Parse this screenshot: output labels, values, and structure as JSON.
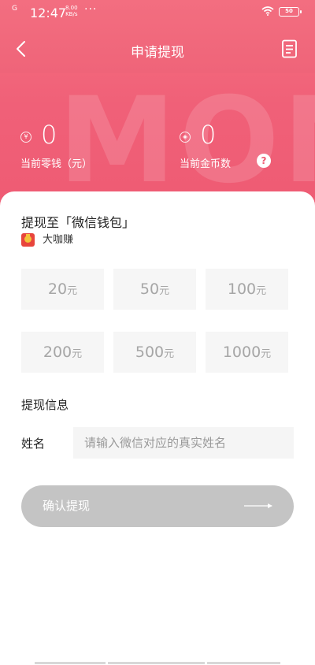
{
  "status_bar": {
    "time": "12:47",
    "signal": "G",
    "speed_value": "8.00",
    "speed_unit": "KB/s",
    "more": "···",
    "battery": "50"
  },
  "nav": {
    "title": "申请提现",
    "back_icon": "chevron-left-icon",
    "record_icon": "document-list-icon"
  },
  "hero": {
    "watermark": "MON",
    "cash": {
      "value": "0",
      "label": "当前零钱（元）",
      "icon": "yuan-coin-icon"
    },
    "coins": {
      "value": "0",
      "label": "当前金币数",
      "icon": "coin-icon",
      "help": "?"
    },
    "colors": {
      "gradient_top": "#f5707f",
      "gradient_bottom": "#ee5a72"
    }
  },
  "withdraw": {
    "to_label": "提现至「微信钱包」",
    "app_name": "大咖赚",
    "amount_unit": "元",
    "amounts": [
      "20",
      "50",
      "100",
      "200",
      "500",
      "1000"
    ]
  },
  "info": {
    "title": "提现信息",
    "name_label": "姓名",
    "name_placeholder": "请输入微信对应的真实姓名",
    "name_value": ""
  },
  "confirm": {
    "label": "确认提现",
    "arrow_icon": "long-arrow-right-icon",
    "color": "#c4c4c4"
  }
}
